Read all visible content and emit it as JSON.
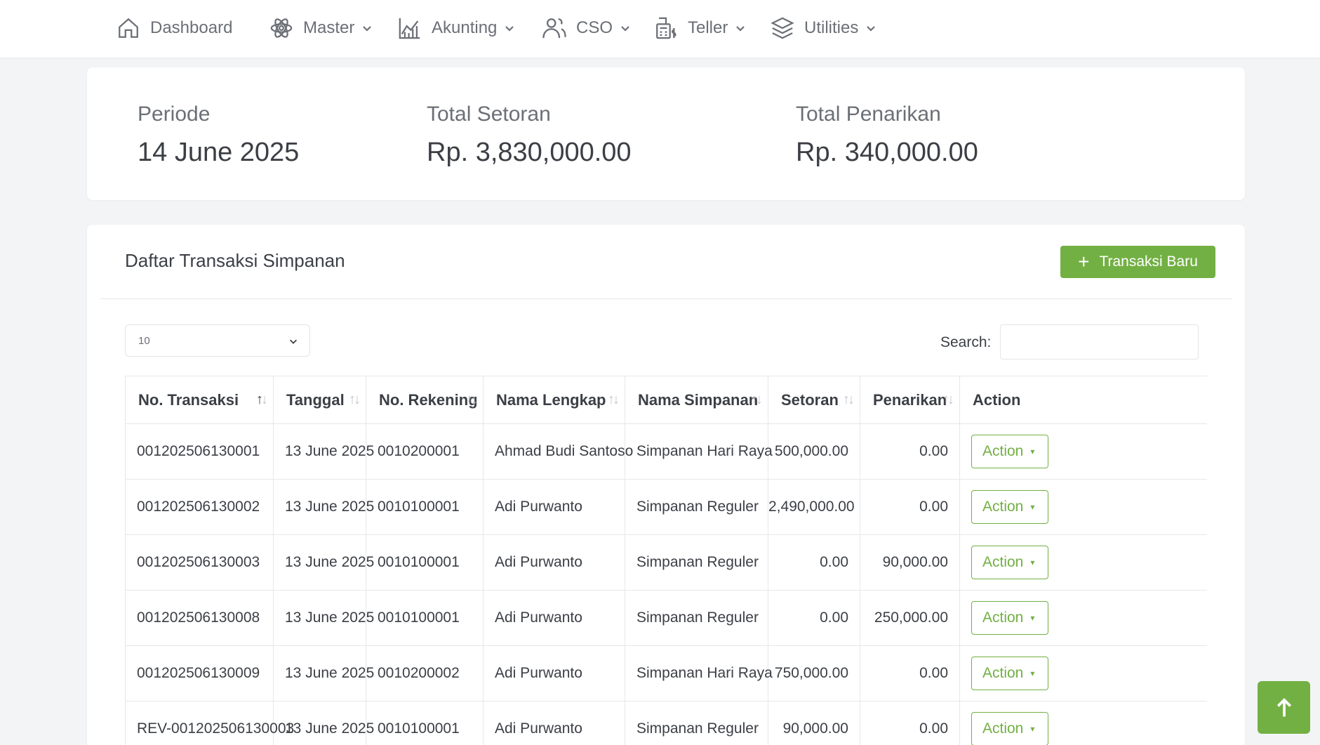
{
  "nav": {
    "dashboard": "Dashboard",
    "master": "Master",
    "akunting": "Akunting",
    "cso": "CSO",
    "teller": "Teller",
    "utilities": "Utilities"
  },
  "stats": {
    "periode_label": "Periode",
    "periode_value": "14 June 2025",
    "setoran_label": "Total Setoran",
    "setoran_value": "Rp. 3,830,000.00",
    "penarikan_label": "Total Penarikan",
    "penarikan_value": "Rp. 340,000.00"
  },
  "list": {
    "title": "Daftar Transaksi Simpanan",
    "new_button": "Transaksi Baru",
    "page_length": "10",
    "search_label": "Search:",
    "search_value": ""
  },
  "table": {
    "headers": [
      "No. Transaksi",
      "Tanggal",
      "No. Rekening",
      "Nama Lengkap",
      "Nama Simpanan",
      "Setoran",
      "Penarikan",
      "Action"
    ],
    "rows": [
      {
        "no": "001202506130001",
        "tanggal": "13 June 2025",
        "rekening": "0010200001",
        "nama": "Ahmad Budi Santoso",
        "simpanan": "Simpanan Hari Raya",
        "setoran": "500,000.00",
        "penarikan": "0.00",
        "action": "Action"
      },
      {
        "no": "001202506130002",
        "tanggal": "13 June 2025",
        "rekening": "0010100001",
        "nama": "Adi Purwanto",
        "simpanan": "Simpanan Reguler",
        "setoran": "2,490,000.00",
        "penarikan": "0.00",
        "action": "Action"
      },
      {
        "no": "001202506130003",
        "tanggal": "13 June 2025",
        "rekening": "0010100001",
        "nama": "Adi Purwanto",
        "simpanan": "Simpanan Reguler",
        "setoran": "0.00",
        "penarikan": "90,000.00",
        "action": "Action"
      },
      {
        "no": "001202506130008",
        "tanggal": "13 June 2025",
        "rekening": "0010100001",
        "nama": "Adi Purwanto",
        "simpanan": "Simpanan Reguler",
        "setoran": "0.00",
        "penarikan": "250,000.00",
        "action": "Action"
      },
      {
        "no": "001202506130009",
        "tanggal": "13 June 2025",
        "rekening": "0010200002",
        "nama": "Adi Purwanto",
        "simpanan": "Simpanan Hari Raya",
        "setoran": "750,000.00",
        "penarikan": "0.00",
        "action": "Action"
      },
      {
        "no": "REV-001202506130003",
        "tanggal": "13 June 2025",
        "rekening": "0010100001",
        "nama": "Adi Purwanto",
        "simpanan": "Simpanan Reguler",
        "setoran": "90,000.00",
        "penarikan": "0.00",
        "action": "Action"
      }
    ]
  },
  "colors": {
    "accent": "#72b043",
    "background": "#f3f4f6",
    "text": "#3b3f45"
  },
  "icons": [
    "home-icon",
    "atom-icon",
    "chart-icon",
    "users-icon",
    "register-icon",
    "layers-icon",
    "chevron-down-icon",
    "plus-icon",
    "arrow-up-icon"
  ]
}
